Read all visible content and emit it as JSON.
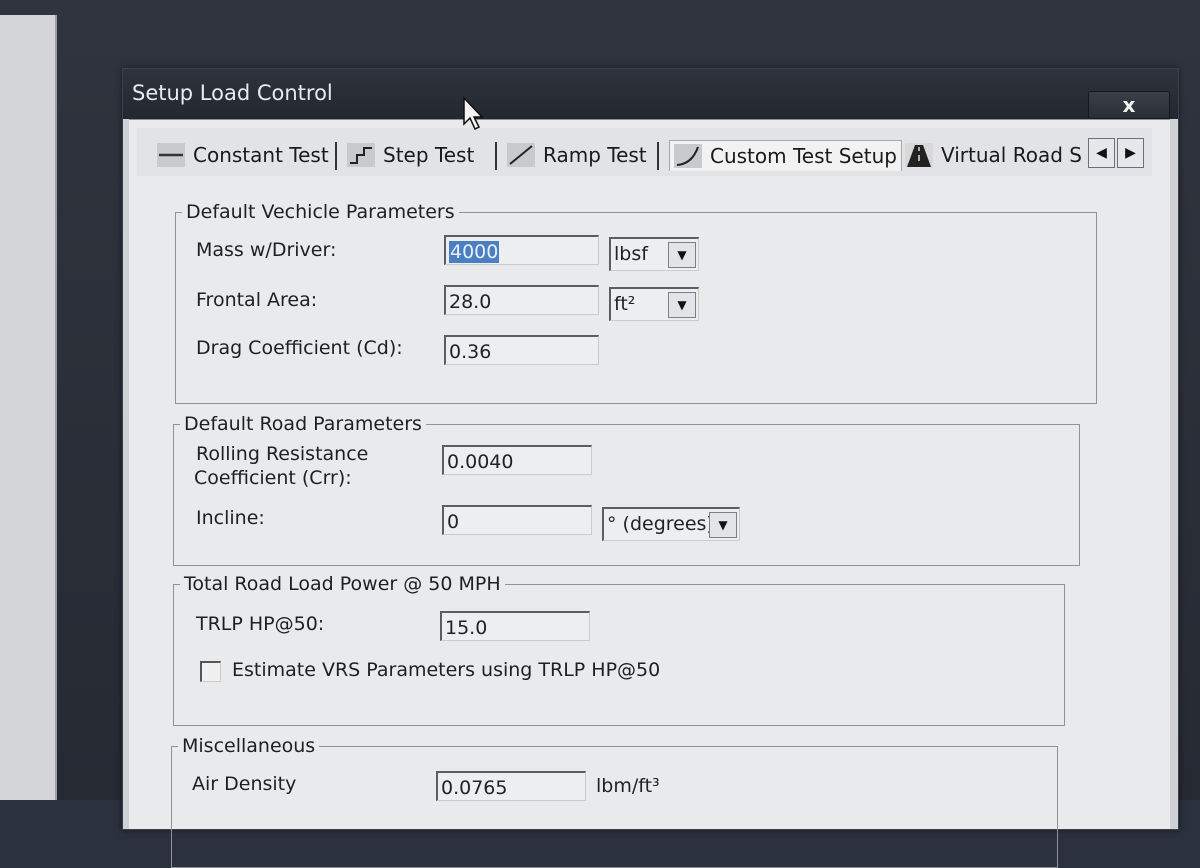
{
  "window": {
    "title": "Setup Load Control",
    "close_label": "x"
  },
  "tabs": [
    {
      "label": "Constant Test",
      "icon": "flat-line-icon"
    },
    {
      "label": "Step Test",
      "icon": "step-icon"
    },
    {
      "label": "Ramp Test",
      "icon": "ramp-icon"
    },
    {
      "label": "Custom Test Setup",
      "icon": "curve-icon"
    },
    {
      "label": "Virtual Road S",
      "icon": "road-icon"
    }
  ],
  "tab_nav": {
    "left": "◀",
    "right": "▶"
  },
  "vehicle": {
    "title": "Default Vechicle Parameters",
    "mass_label": "Mass w/Driver:",
    "mass_value": "4000",
    "mass_unit": "lbsf",
    "area_label": "Frontal Area:",
    "area_value": "28.0",
    "area_unit": "ft²",
    "drag_label": "Drag Coefficient (Cd):",
    "drag_value": "0.36"
  },
  "road": {
    "title": "Default Road Parameters",
    "rolling_label_1": "Rolling Resistance",
    "rolling_label_2": "Coefficient (Crr):",
    "rolling_value": "0.0040",
    "incline_label": "Incline:",
    "incline_value": "0",
    "incline_unit": "° (degrees)"
  },
  "trlp": {
    "title": "Total Road Load Power @ 50 MPH",
    "hp_label": "TRLP HP@50:",
    "hp_value": "15.0",
    "estimate_label": "Estimate VRS Parameters using TRLP HP@50"
  },
  "misc": {
    "title": "Miscellaneous",
    "air_label": "Air Density",
    "air_value": "0.0765",
    "air_unit": "lbm/ft³"
  }
}
